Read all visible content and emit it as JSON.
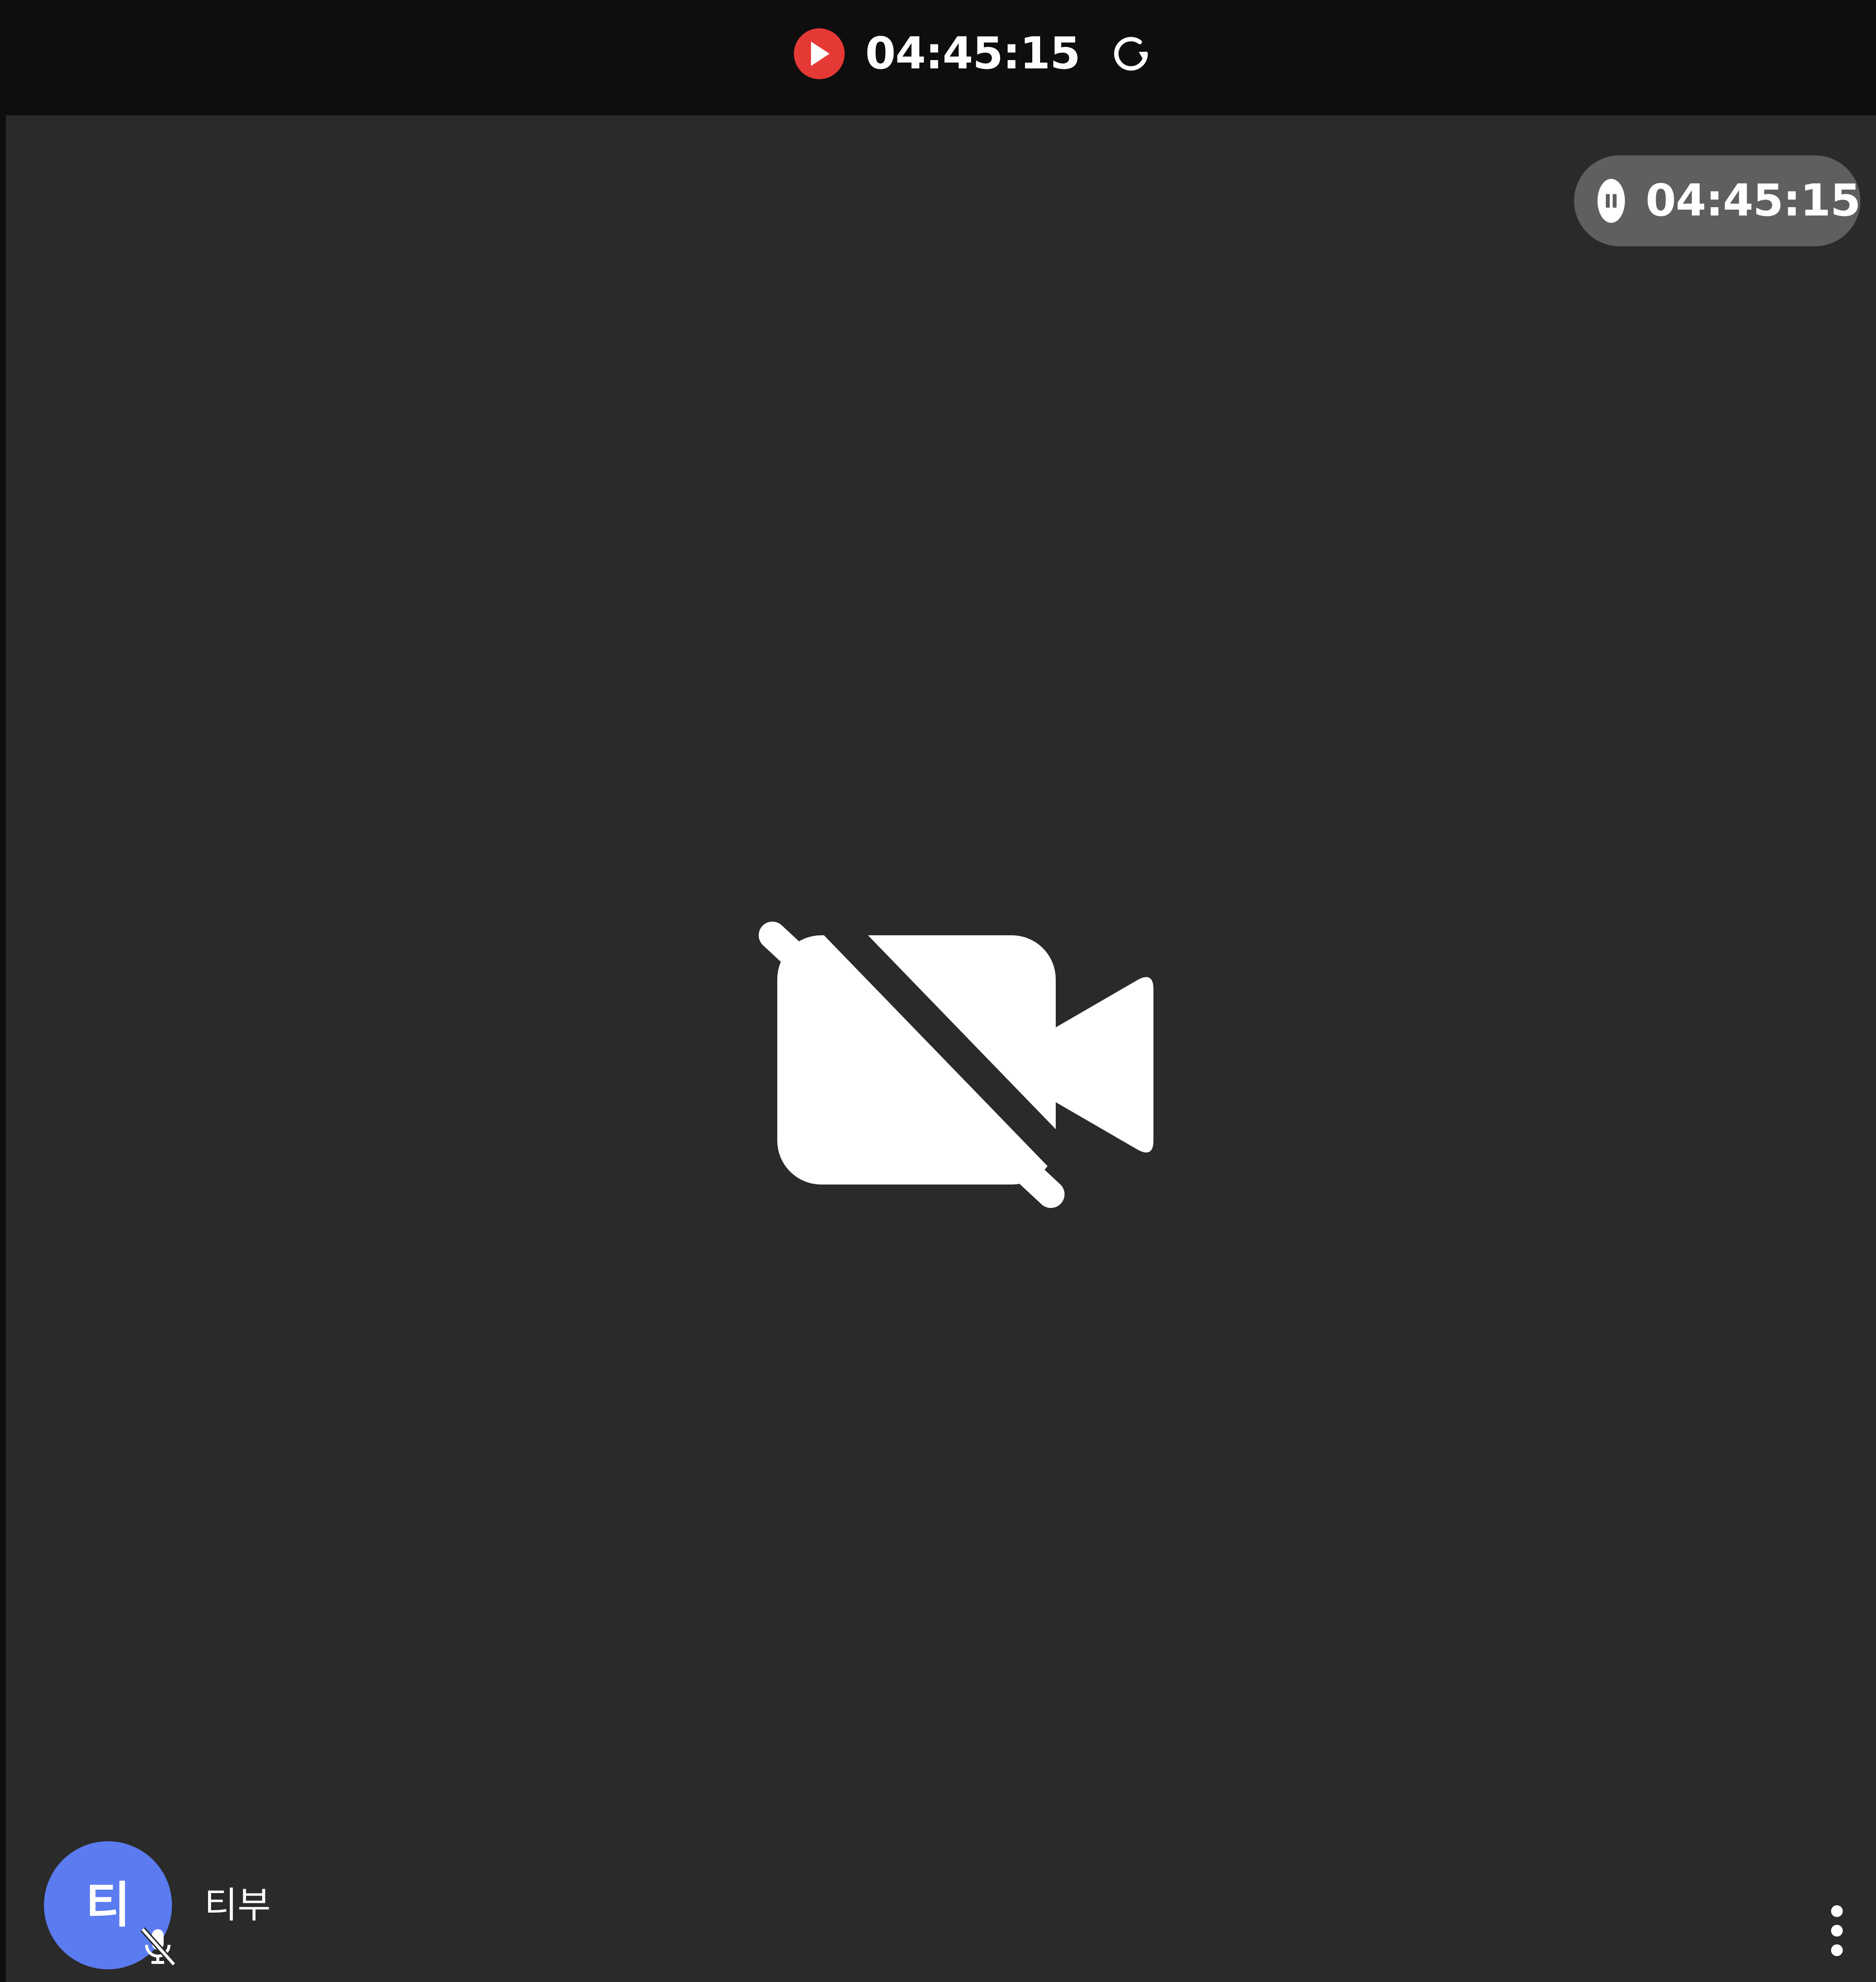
{
  "top_bar": {
    "record_icon": "record-play-icon",
    "elapsed_time": "04:45:15",
    "refresh_icon": "refresh-icon",
    "record_color": "#e53935"
  },
  "video_tile": {
    "timer_pill": {
      "pause_icon": "pause-icon",
      "elapsed_time": "04:45:15"
    },
    "center_icon": "camera-off-icon",
    "participant": {
      "initial": "티",
      "name": "티부",
      "avatar_color": "#5b7bf0",
      "mic_icon": "mic-off-icon"
    },
    "menu_icon": "more-vertical-icon"
  }
}
